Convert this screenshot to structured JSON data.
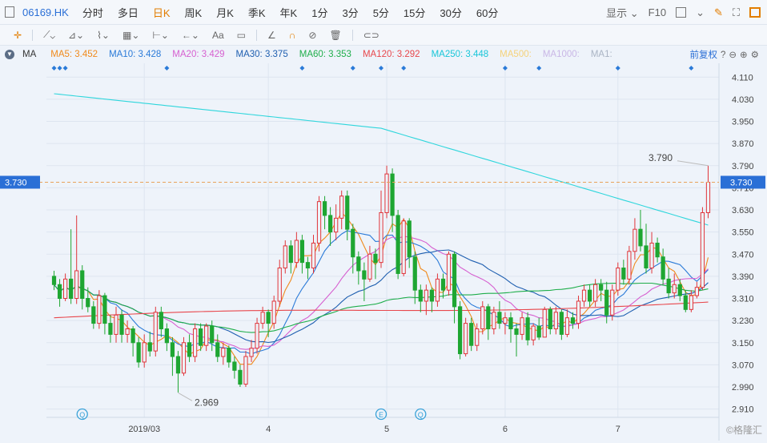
{
  "header": {
    "symbol": "06169.HK",
    "periods": [
      "分时",
      "多日",
      "日K",
      "周K",
      "月K",
      "季K",
      "年K",
      "1分",
      "3分",
      "5分",
      "15分",
      "30分",
      "60分"
    ],
    "active_period": "日K",
    "display_label": "显示",
    "f10_label": "F10"
  },
  "draw_toolbar": {
    "text_tool": "Aa"
  },
  "ma_bar": {
    "label": "MA",
    "items": [
      {
        "text": "MA5: 3.452",
        "color": "#f08a1c"
      },
      {
        "text": "MA10: 3.428",
        "color": "#2a7ad8"
      },
      {
        "text": "MA20: 3.429",
        "color": "#d65fd0"
      },
      {
        "text": "MA30: 3.375",
        "color": "#1f5fb0"
      },
      {
        "text": "MA60: 3.353",
        "color": "#1fae4b"
      },
      {
        "text": "MA120: 3.292",
        "color": "#e8474c"
      },
      {
        "text": "MA250: 3.448",
        "color": "#18c6d8"
      },
      {
        "text": "MA500:",
        "color": "#f5d27a"
      },
      {
        "text": "MA1000:",
        "color": "#c9b7e6"
      },
      {
        "text": "MA1:",
        "color": "#aab4c4"
      }
    ],
    "adjust_label": "前复权"
  },
  "chart_data": {
    "type": "candlestick",
    "y_ticks": [
      "4.110",
      "4.030",
      "3.950",
      "3.870",
      "3.790",
      "3.710",
      "3.630",
      "3.550",
      "3.470",
      "3.390",
      "3.310",
      "3.230",
      "3.150",
      "3.070",
      "2.990",
      "2.910"
    ],
    "ylim": [
      2.88,
      4.16
    ],
    "x_labels": [
      {
        "label": "2019/03",
        "index": 16
      },
      {
        "label": "4",
        "index": 38
      },
      {
        "label": "5",
        "index": 59
      },
      {
        "label": "6",
        "index": 80
      },
      {
        "label": "7",
        "index": 100
      }
    ],
    "current_price": "3.730",
    "high_annotation": "3.790",
    "low_annotation": "2.969",
    "watermark": "©格隆汇",
    "event_markers": [
      "Q",
      "E",
      "Q"
    ],
    "colors": {
      "up": "#e0353a",
      "down": "#1ea632",
      "ma250": "#2fd6dc"
    },
    "candles": [
      [
        3.39,
        3.36,
        3.41,
        3.34
      ],
      [
        3.36,
        3.31,
        3.38,
        3.28
      ],
      [
        3.31,
        3.38,
        3.4,
        3.3
      ],
      [
        3.38,
        3.31,
        3.56,
        3.29
      ],
      [
        3.31,
        3.41,
        3.61,
        3.29
      ],
      [
        3.41,
        3.31,
        3.43,
        3.27
      ],
      [
        3.31,
        3.28,
        3.35,
        3.26
      ],
      [
        3.28,
        3.22,
        3.3,
        3.2
      ],
      [
        3.22,
        3.32,
        3.34,
        3.2
      ],
      [
        3.32,
        3.22,
        3.33,
        3.18
      ],
      [
        3.22,
        3.18,
        3.25,
        3.15
      ],
      [
        3.18,
        3.25,
        3.28,
        3.15
      ],
      [
        3.25,
        3.18,
        3.27,
        3.15
      ],
      [
        3.18,
        3.2,
        3.23,
        3.15
      ],
      [
        3.2,
        3.15,
        3.21,
        3.1
      ],
      [
        3.15,
        3.08,
        3.17,
        3.06
      ],
      [
        3.08,
        3.15,
        3.18,
        3.06
      ],
      [
        3.15,
        3.12,
        3.19,
        3.1
      ],
      [
        3.12,
        3.26,
        3.28,
        3.1
      ],
      [
        3.26,
        3.2,
        3.28,
        3.17
      ],
      [
        3.2,
        3.15,
        3.22,
        3.12
      ],
      [
        3.15,
        3.1,
        3.17,
        3.03
      ],
      [
        3.1,
        3.04,
        3.12,
        2.97
      ],
      [
        3.04,
        3.15,
        3.17,
        3.03
      ],
      [
        3.15,
        3.1,
        3.18,
        3.08
      ],
      [
        3.1,
        3.2,
        3.22,
        3.08
      ],
      [
        3.2,
        3.14,
        3.22,
        3.12
      ],
      [
        3.14,
        3.21,
        3.22,
        3.12
      ],
      [
        3.21,
        3.15,
        3.23,
        3.12
      ],
      [
        3.15,
        3.1,
        3.18,
        3.08
      ],
      [
        3.1,
        3.13,
        3.15,
        3.07
      ],
      [
        3.13,
        3.08,
        3.14,
        3.06
      ],
      [
        3.08,
        3.05,
        3.1,
        3.02
      ],
      [
        3.05,
        3.0,
        3.07,
        2.99
      ],
      [
        3.0,
        3.1,
        3.12,
        2.99
      ],
      [
        3.1,
        3.13,
        3.16,
        3.08
      ],
      [
        3.13,
        3.22,
        3.24,
        3.11
      ],
      [
        3.22,
        3.26,
        3.28,
        3.2
      ],
      [
        3.26,
        3.22,
        3.27,
        3.17
      ],
      [
        3.22,
        3.3,
        3.32,
        3.2
      ],
      [
        3.3,
        3.42,
        3.45,
        3.28
      ],
      [
        3.42,
        3.5,
        3.52,
        3.4
      ],
      [
        3.5,
        3.44,
        3.52,
        3.4
      ],
      [
        3.44,
        3.52,
        3.55,
        3.42
      ],
      [
        3.52,
        3.44,
        3.54,
        3.4
      ],
      [
        3.44,
        3.42,
        3.46,
        3.38
      ],
      [
        3.42,
        3.51,
        3.54,
        3.4
      ],
      [
        3.51,
        3.66,
        3.68,
        3.48
      ],
      [
        3.66,
        3.61,
        3.68,
        3.56
      ],
      [
        3.61,
        3.55,
        3.64,
        3.5
      ],
      [
        3.55,
        3.6,
        3.65,
        3.52
      ],
      [
        3.6,
        3.68,
        3.7,
        3.56
      ],
      [
        3.68,
        3.56,
        3.7,
        3.52
      ],
      [
        3.56,
        3.46,
        3.58,
        3.4
      ],
      [
        3.46,
        3.41,
        3.48,
        3.36
      ],
      [
        3.41,
        3.38,
        3.44,
        3.3
      ],
      [
        3.38,
        3.47,
        3.5,
        3.37
      ],
      [
        3.47,
        3.44,
        3.49,
        3.38
      ],
      [
        3.44,
        3.62,
        3.7,
        3.42
      ],
      [
        3.62,
        3.76,
        3.79,
        3.6
      ],
      [
        3.76,
        3.61,
        3.78,
        3.55
      ],
      [
        3.61,
        3.4,
        3.63,
        3.38
      ],
      [
        3.4,
        3.59,
        3.6,
        3.39
      ],
      [
        3.59,
        3.46,
        3.6,
        3.42
      ],
      [
        3.46,
        3.34,
        3.48,
        3.29
      ],
      [
        3.34,
        3.3,
        3.36,
        3.26
      ],
      [
        3.3,
        3.34,
        3.36,
        3.25
      ],
      [
        3.34,
        3.3,
        3.35,
        3.26
      ],
      [
        3.3,
        3.38,
        3.4,
        3.28
      ],
      [
        3.38,
        3.34,
        3.4,
        3.31
      ],
      [
        3.34,
        3.47,
        3.48,
        3.32
      ],
      [
        3.47,
        3.28,
        3.48,
        3.22
      ],
      [
        3.28,
        3.11,
        3.3,
        3.09
      ],
      [
        3.11,
        3.22,
        3.24,
        3.1
      ],
      [
        3.22,
        3.14,
        3.24,
        3.12
      ],
      [
        3.14,
        3.2,
        3.22,
        3.12
      ],
      [
        3.2,
        3.28,
        3.3,
        3.18
      ],
      [
        3.28,
        3.2,
        3.29,
        3.16
      ],
      [
        3.2,
        3.26,
        3.28,
        3.18
      ],
      [
        3.26,
        3.22,
        3.3,
        3.2
      ],
      [
        3.22,
        3.24,
        3.26,
        3.18
      ],
      [
        3.24,
        3.2,
        3.26,
        3.15
      ],
      [
        3.2,
        3.18,
        3.22,
        3.1
      ],
      [
        3.18,
        3.24,
        3.26,
        3.16
      ],
      [
        3.24,
        3.16,
        3.26,
        3.14
      ],
      [
        3.16,
        3.21,
        3.22,
        3.14
      ],
      [
        3.21,
        3.17,
        3.24,
        3.16
      ],
      [
        3.17,
        3.27,
        3.28,
        3.17
      ],
      [
        3.27,
        3.2,
        3.28,
        3.18
      ],
      [
        3.2,
        3.26,
        3.28,
        3.18
      ],
      [
        3.26,
        3.18,
        3.27,
        3.16
      ],
      [
        3.18,
        3.24,
        3.27,
        3.17
      ],
      [
        3.24,
        3.22,
        3.26,
        3.2
      ],
      [
        3.22,
        3.3,
        3.32,
        3.2
      ],
      [
        3.3,
        3.34,
        3.36,
        3.28
      ],
      [
        3.34,
        3.3,
        3.36,
        3.28
      ],
      [
        3.3,
        3.36,
        3.38,
        3.28
      ],
      [
        3.36,
        3.34,
        3.38,
        3.3
      ],
      [
        3.34,
        3.25,
        3.37,
        3.22
      ],
      [
        3.25,
        3.34,
        3.36,
        3.23
      ],
      [
        3.34,
        3.42,
        3.44,
        3.32
      ],
      [
        3.42,
        3.38,
        3.45,
        3.36
      ],
      [
        3.38,
        3.48,
        3.5,
        3.36
      ],
      [
        3.48,
        3.56,
        3.6,
        3.45
      ],
      [
        3.56,
        3.5,
        3.63,
        3.48
      ],
      [
        3.5,
        3.42,
        3.58,
        3.4
      ],
      [
        3.42,
        3.51,
        3.55,
        3.4
      ],
      [
        3.51,
        3.46,
        3.53,
        3.44
      ],
      [
        3.46,
        3.38,
        3.49,
        3.36
      ],
      [
        3.38,
        3.33,
        3.42,
        3.31
      ],
      [
        3.33,
        3.36,
        3.4,
        3.31
      ],
      [
        3.36,
        3.32,
        3.38,
        3.3
      ],
      [
        3.32,
        3.27,
        3.34,
        3.26
      ],
      [
        3.27,
        3.32,
        3.34,
        3.26
      ],
      [
        3.32,
        3.35,
        3.37,
        3.31
      ],
      [
        3.35,
        3.62,
        3.64,
        3.34
      ],
      [
        3.62,
        3.73,
        3.79,
        3.6
      ]
    ]
  }
}
